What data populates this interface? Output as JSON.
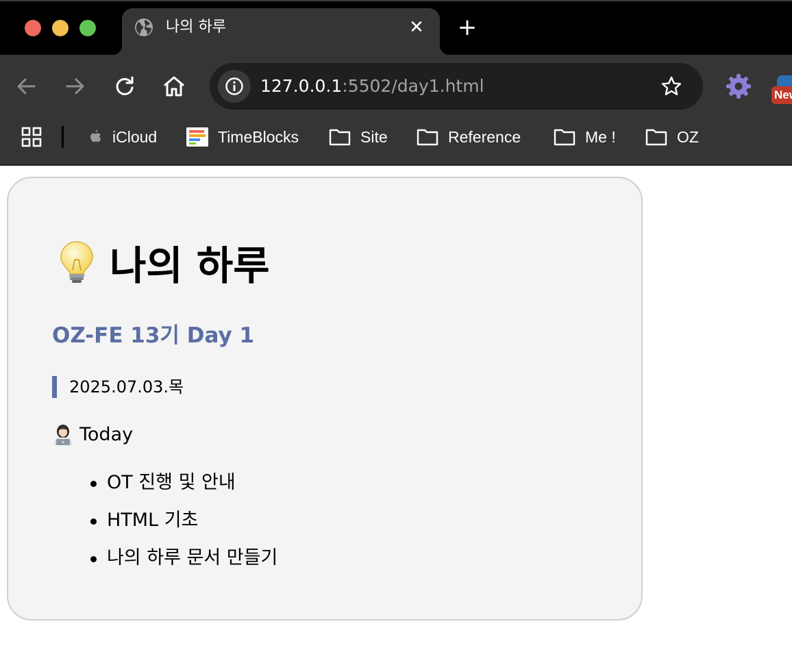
{
  "browser": {
    "tab": {
      "title": "나의 하루",
      "favicon": "globe-icon"
    },
    "new_tab_label": "+",
    "address_bar": {
      "host": "127.0.0.1",
      "path": ":5502/day1.html"
    },
    "extension_badge": "New",
    "bookmarks": [
      {
        "label": "iCloud",
        "icon": "apple-icon"
      },
      {
        "label": "TimeBlocks",
        "icon": "timeblocks-icon"
      },
      {
        "label": "Site",
        "icon": "folder-icon"
      },
      {
        "label": "Reference",
        "icon": "folder-icon"
      },
      {
        "label": "Me !",
        "icon": "folder-icon"
      },
      {
        "label": "OZ",
        "icon": "folder-icon"
      }
    ]
  },
  "page": {
    "title": "나의 하루",
    "title_icon": "lightbulb-icon",
    "subtitle": "OZ-FE 13기 Day 1",
    "date": "2025.07.03.목",
    "today_heading": "Today",
    "today_icon": "person-laptop-icon",
    "today_items": [
      "OT 진행 및 안내",
      "HTML 기초",
      "나의 하루 문서 만들기"
    ]
  },
  "colors": {
    "accent": "#5b6ea4",
    "card_background": "#f4f4f4",
    "toolbar": "#353535"
  }
}
